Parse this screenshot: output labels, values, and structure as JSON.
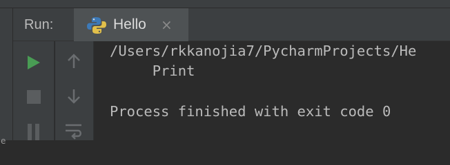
{
  "window": {
    "left_edge_glyph": "e"
  },
  "run_panel": {
    "label": "Run:",
    "tab": {
      "label": "Hello",
      "icon": "python-icon",
      "close_icon": "close-icon"
    }
  },
  "toolbar": {
    "icons": [
      "run-icon",
      "stop-icon",
      "pause-icon",
      "up-arrow-icon",
      "down-arrow-icon",
      "soft-wrap-icon"
    ]
  },
  "console": {
    "lines": [
      "/Users/rkkanojia7/PycharmProjects/He",
      "     Print",
      "",
      "Process finished with exit code 0"
    ]
  },
  "colors": {
    "panel": "#3c3f41",
    "console_bg": "#2b2b2b",
    "text": "#bbbbbb",
    "run_green": "#499c54"
  }
}
